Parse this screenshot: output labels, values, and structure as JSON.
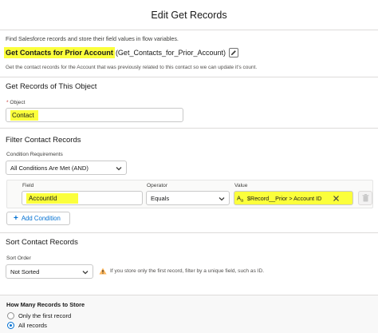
{
  "modal": {
    "title": "Edit Get Records"
  },
  "description": "Find Salesforce records and store their field values in flow variables.",
  "element": {
    "label": "Get Contacts for Prior Account",
    "api_name": "(Get_Contacts_for_Prior_Account)",
    "sub_description": "Get the contact records for the Account that was previously related to this contact so we can update it's count."
  },
  "get_records": {
    "section_title": "Get Records of This Object",
    "object_label_required": "*",
    "object_label": "Object",
    "object_value": "Contact"
  },
  "filter": {
    "section_title": "Filter Contact Records",
    "condition_label": "Condition Requirements",
    "condition_value": "All Conditions Are Met (AND)",
    "field_label": "Field",
    "field_value": "AccountId",
    "operator_label": "Operator",
    "operator_value": "Equals",
    "value_label": "Value",
    "value_text": "$Record__Prior > Account ID",
    "add_condition_label": "Add Condition"
  },
  "sort": {
    "section_title": "Sort Contact Records",
    "order_label": "Sort Order",
    "order_value": "Not Sorted",
    "warning_text": "If you store only the first record, filter by a unique field, such as ID."
  },
  "records": {
    "title": "How Many Records to Store",
    "options": [
      {
        "label": "Only the first record",
        "selected": false
      },
      {
        "label": "All records",
        "selected": true
      }
    ]
  },
  "colors": {
    "highlight": "#fbff3c",
    "accent": "#0070d2",
    "warning": "#ffb75d"
  },
  "icons": [
    "pencil-icon",
    "chevron-down-icon",
    "resource-icon",
    "close-icon",
    "trash-icon",
    "plus-icon",
    "warning-icon"
  ]
}
